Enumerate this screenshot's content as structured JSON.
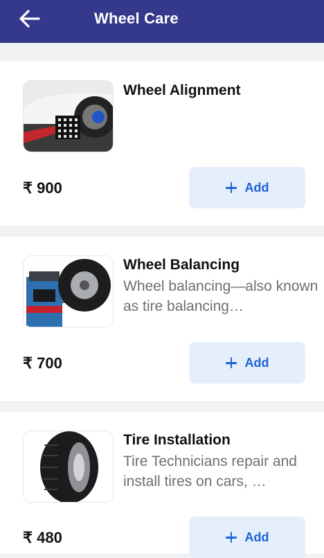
{
  "header": {
    "title": "Wheel Care",
    "back_icon": "arrow-left-icon"
  },
  "services": [
    {
      "name": "Wheel Alignment",
      "description": "",
      "price": "₹ 900",
      "add_label": "Add",
      "image": "wheel-alignment-photo"
    },
    {
      "name": "Wheel Balancing",
      "description": "Wheel balancing—also known as tire balancing…",
      "price": "₹ 700",
      "add_label": "Add",
      "image": "wheel-balancer-machine-photo"
    },
    {
      "name": "Tire Installation",
      "description": "Tire Technicians repair and install tires on cars, …",
      "price": "₹ 480",
      "add_label": "Add",
      "image": "tire-photo"
    }
  ],
  "colors": {
    "appbar": "#34398b",
    "accent": "#1f63d8",
    "button_bg": "#e5eefb"
  }
}
